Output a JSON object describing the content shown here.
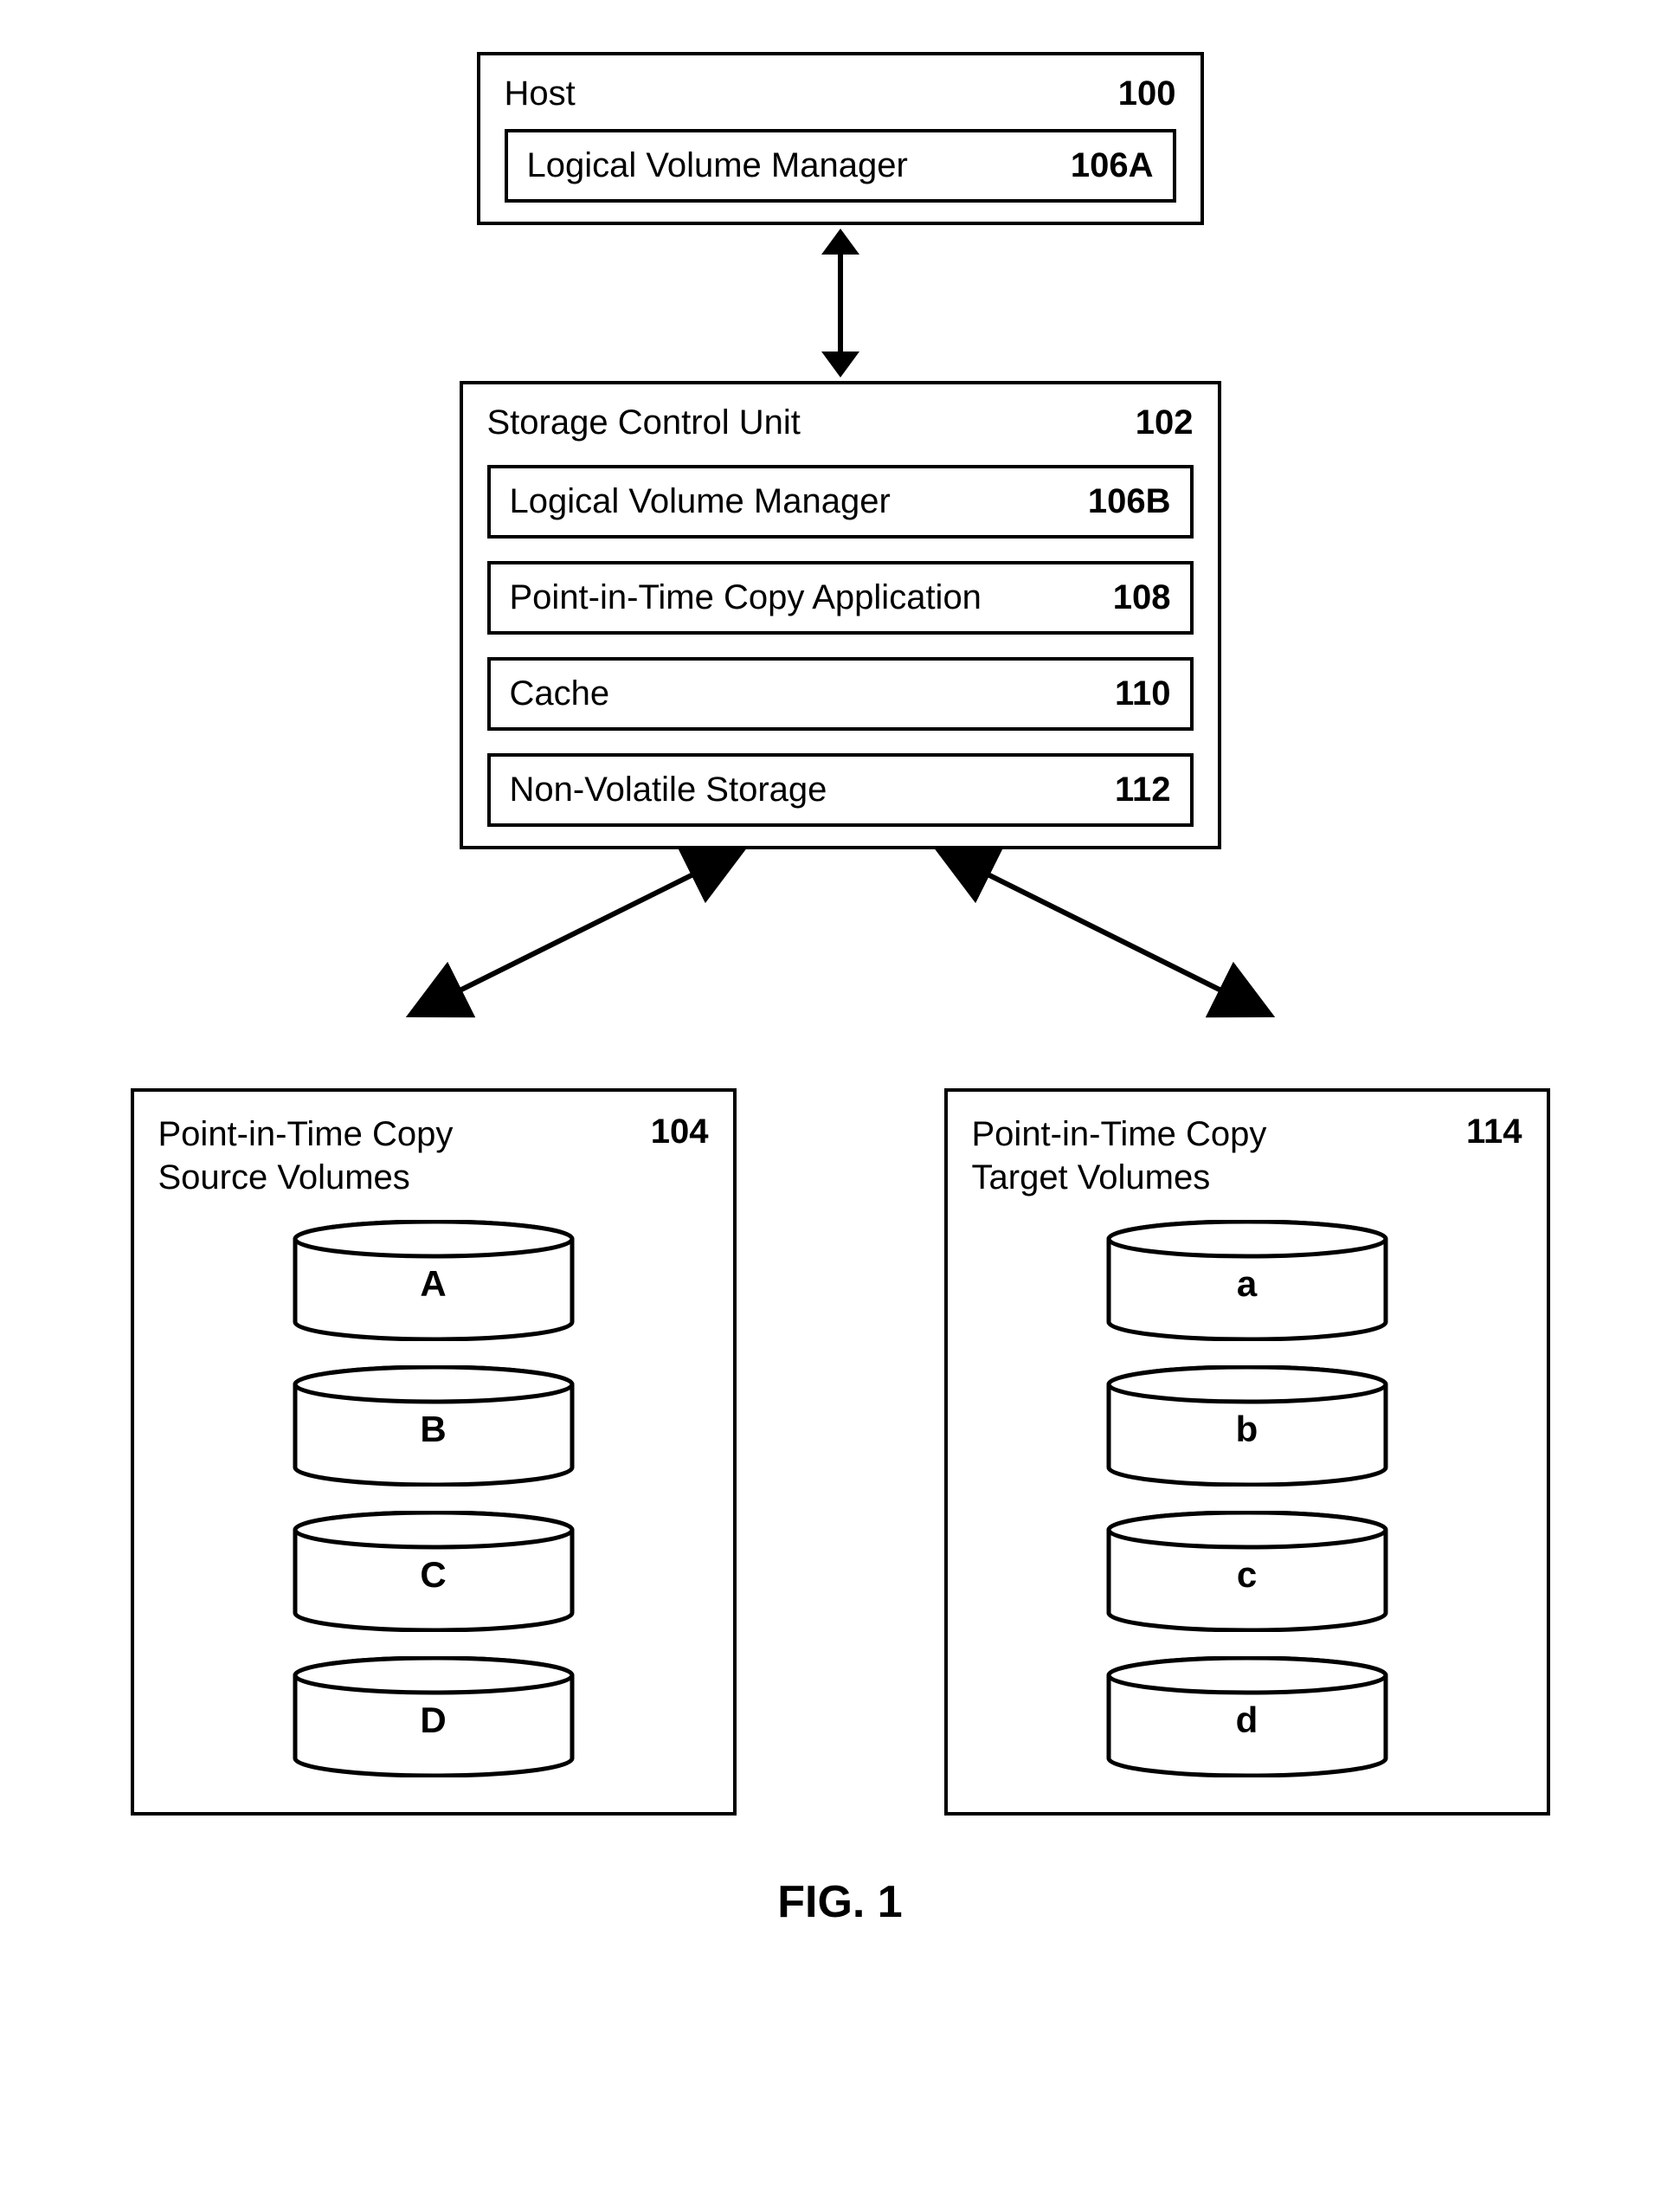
{
  "host": {
    "label": "Host",
    "ref": "100",
    "lvm": {
      "label": "Logical Volume Manager",
      "ref": "106A"
    }
  },
  "scu": {
    "label": "Storage Control Unit",
    "ref": "102",
    "lvm": {
      "label": "Logical Volume Manager",
      "ref": "106B"
    },
    "pit": {
      "label": "Point-in-Time Copy Application",
      "ref": "108"
    },
    "cache": {
      "label": "Cache",
      "ref": "110"
    },
    "nvs": {
      "label": "Non-Volatile Storage",
      "ref": "112"
    }
  },
  "source": {
    "title": "Point-in-Time Copy Source Volumes",
    "ref": "104",
    "vols": [
      "A",
      "B",
      "C",
      "D"
    ]
  },
  "target": {
    "title": "Point-in-Time Copy Target Volumes",
    "ref": "114",
    "vols": [
      "a",
      "b",
      "c",
      "d"
    ]
  },
  "figure_label": "FIG. 1"
}
